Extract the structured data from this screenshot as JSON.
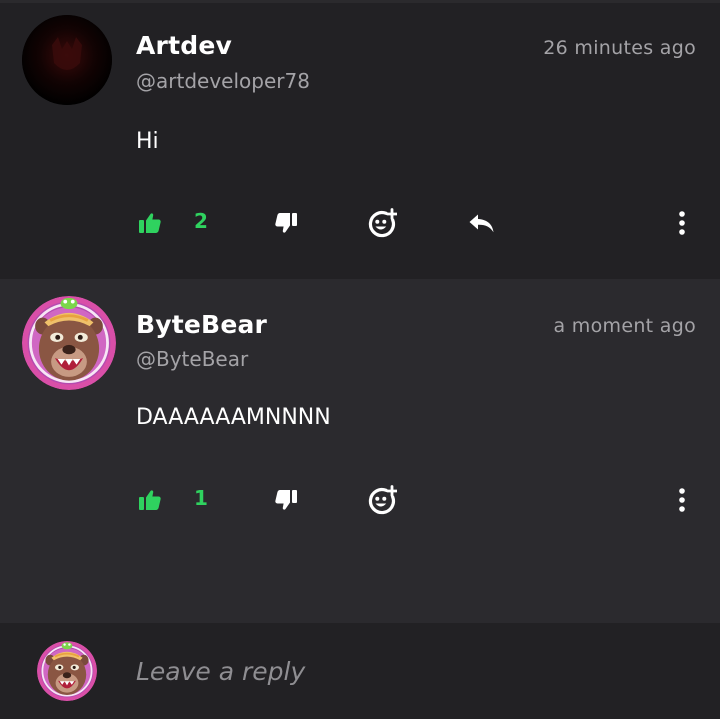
{
  "comments": [
    {
      "username": "Artdev",
      "handle": "@artdeveloper78",
      "time": "26 minutes ago",
      "body": "Hi",
      "likes": "2",
      "has_reply": true
    },
    {
      "username": "ByteBear",
      "handle": "@ByteBear",
      "time": "a moment ago",
      "body": "DAAAAAAMNNNN",
      "likes": "1",
      "has_reply": false
    }
  ],
  "composer": {
    "placeholder": "Leave a reply"
  },
  "icons": {
    "like": "thumbs-up-icon",
    "dislike": "thumbs-down-icon",
    "emoji": "add-reaction-icon",
    "reply": "reply-arrow-icon",
    "more": "more-vertical-icon"
  },
  "colors": {
    "like_accent": "#2fd25f",
    "background": "#222124",
    "highlight_background": "#2b2a2e",
    "muted_text": "#a4a3a7"
  }
}
